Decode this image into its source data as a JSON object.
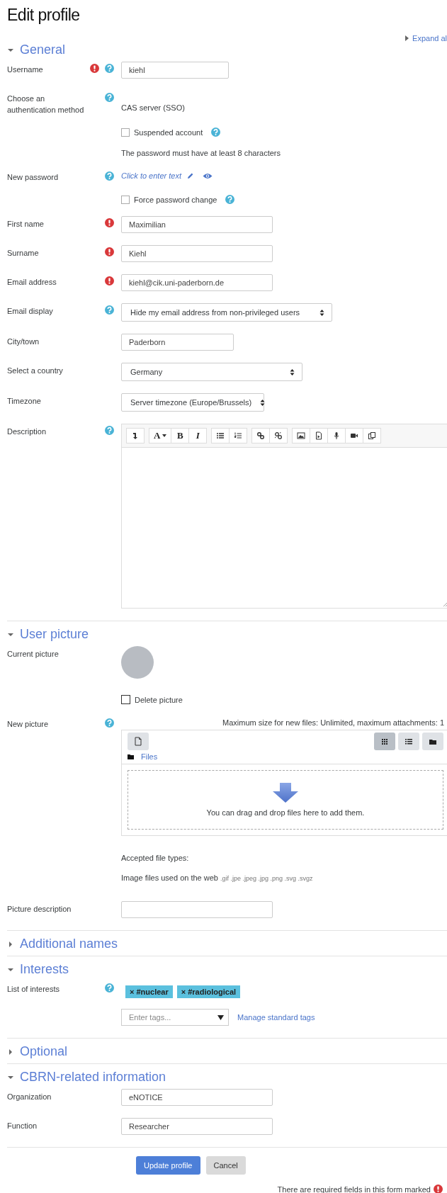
{
  "title": "Edit profile",
  "expand_all": "Expand al",
  "sections": [
    {
      "title": "General",
      "expanded": true,
      "rows": [
        {
          "kind": "input",
          "label": "Username",
          "required": true,
          "help": true,
          "value": "kiehl"
        },
        {
          "kind": "static",
          "label": "Choose an authentication method",
          "required": false,
          "help": true,
          "text": "CAS server (SSO)"
        },
        {
          "kind": "checkbox",
          "text": "Suspended account",
          "checked": false,
          "help": true
        },
        {
          "kind": "note",
          "text": "The password must have at least 8 characters"
        },
        {
          "kind": "password",
          "label": "New password",
          "required": false,
          "help": true,
          "link": "Click to enter text"
        },
        {
          "kind": "checkbox",
          "text": "Force password change",
          "checked": false,
          "help": true
        },
        {
          "kind": "input",
          "label": "First name",
          "required": true,
          "help": false,
          "value": "Maximilian"
        },
        {
          "kind": "input",
          "label": "Surname",
          "required": true,
          "help": false,
          "value": "Kiehl"
        },
        {
          "kind": "input",
          "label": "Email address",
          "required": true,
          "help": false,
          "value": "kiehl@cik.uni-paderborn.de"
        },
        {
          "kind": "select",
          "label": "Email display",
          "required": false,
          "help": true,
          "value": "Hide my email address from non-privileged users"
        },
        {
          "kind": "input",
          "label": "City/town",
          "required": false,
          "help": false,
          "value": "Paderborn"
        },
        {
          "kind": "select",
          "label": "Select a country",
          "required": false,
          "help": false,
          "value": "Germany"
        },
        {
          "kind": "select",
          "label": "Timezone",
          "required": false,
          "help": false,
          "value": "Server timezone (Europe/Brussels)"
        },
        {
          "kind": "editor",
          "label": "Description",
          "required": false,
          "help": true,
          "toolbar": {
            "font": "A",
            "bold": "B",
            "italic": "I"
          }
        }
      ]
    },
    {
      "title": "User picture",
      "expanded": true,
      "rows": [
        {
          "kind": "avatar",
          "label": "Current picture",
          "required": false,
          "help": false
        },
        {
          "kind": "checkbox",
          "text": "Delete picture",
          "checked": false,
          "help": false
        },
        {
          "kind": "filepicker",
          "label": "New picture",
          "required": false,
          "help": true,
          "max_size": "Maximum size for new files: Unlimited, maximum attachments: 1",
          "views": [
            {
              "selected": true
            },
            {
              "selected": false
            },
            {
              "selected": false
            }
          ],
          "folder": "Files",
          "drop_text": "You can drag and drop files here to add them."
        },
        {
          "kind": "filetypes",
          "heading": "Accepted file types:",
          "text": "Image files used on the web",
          "extensions": ".gif .jpe .jpeg .jpg .png .svg .svgz"
        },
        {
          "kind": "input",
          "label": "Picture description",
          "required": false,
          "help": false
        }
      ]
    },
    {
      "title": "Additional names",
      "expanded": false
    },
    {
      "title": "Interests",
      "expanded": true,
      "rows": [
        {
          "kind": "tags",
          "label": "List of interests",
          "required": false,
          "help": true,
          "tags": [
            "× #nuclear",
            "× #radiological"
          ],
          "placeholder": "Enter tags...",
          "link": "Manage standard tags"
        }
      ]
    },
    {
      "title": "Optional",
      "expanded": false
    },
    {
      "title": "CBRN-related information",
      "expanded": true,
      "rows": [
        {
          "kind": "input",
          "label": "Organization",
          "required": false,
          "help": false,
          "value": "eNOTICE"
        },
        {
          "kind": "input",
          "label": "Function",
          "required": false,
          "help": false,
          "value": "Researcher"
        }
      ]
    }
  ],
  "buttons": [
    {
      "kind": "primary",
      "label": "Update profile"
    },
    {
      "kind": "secondary",
      "label": "Cancel"
    }
  ],
  "footer": "There are required fields in this form marked"
}
